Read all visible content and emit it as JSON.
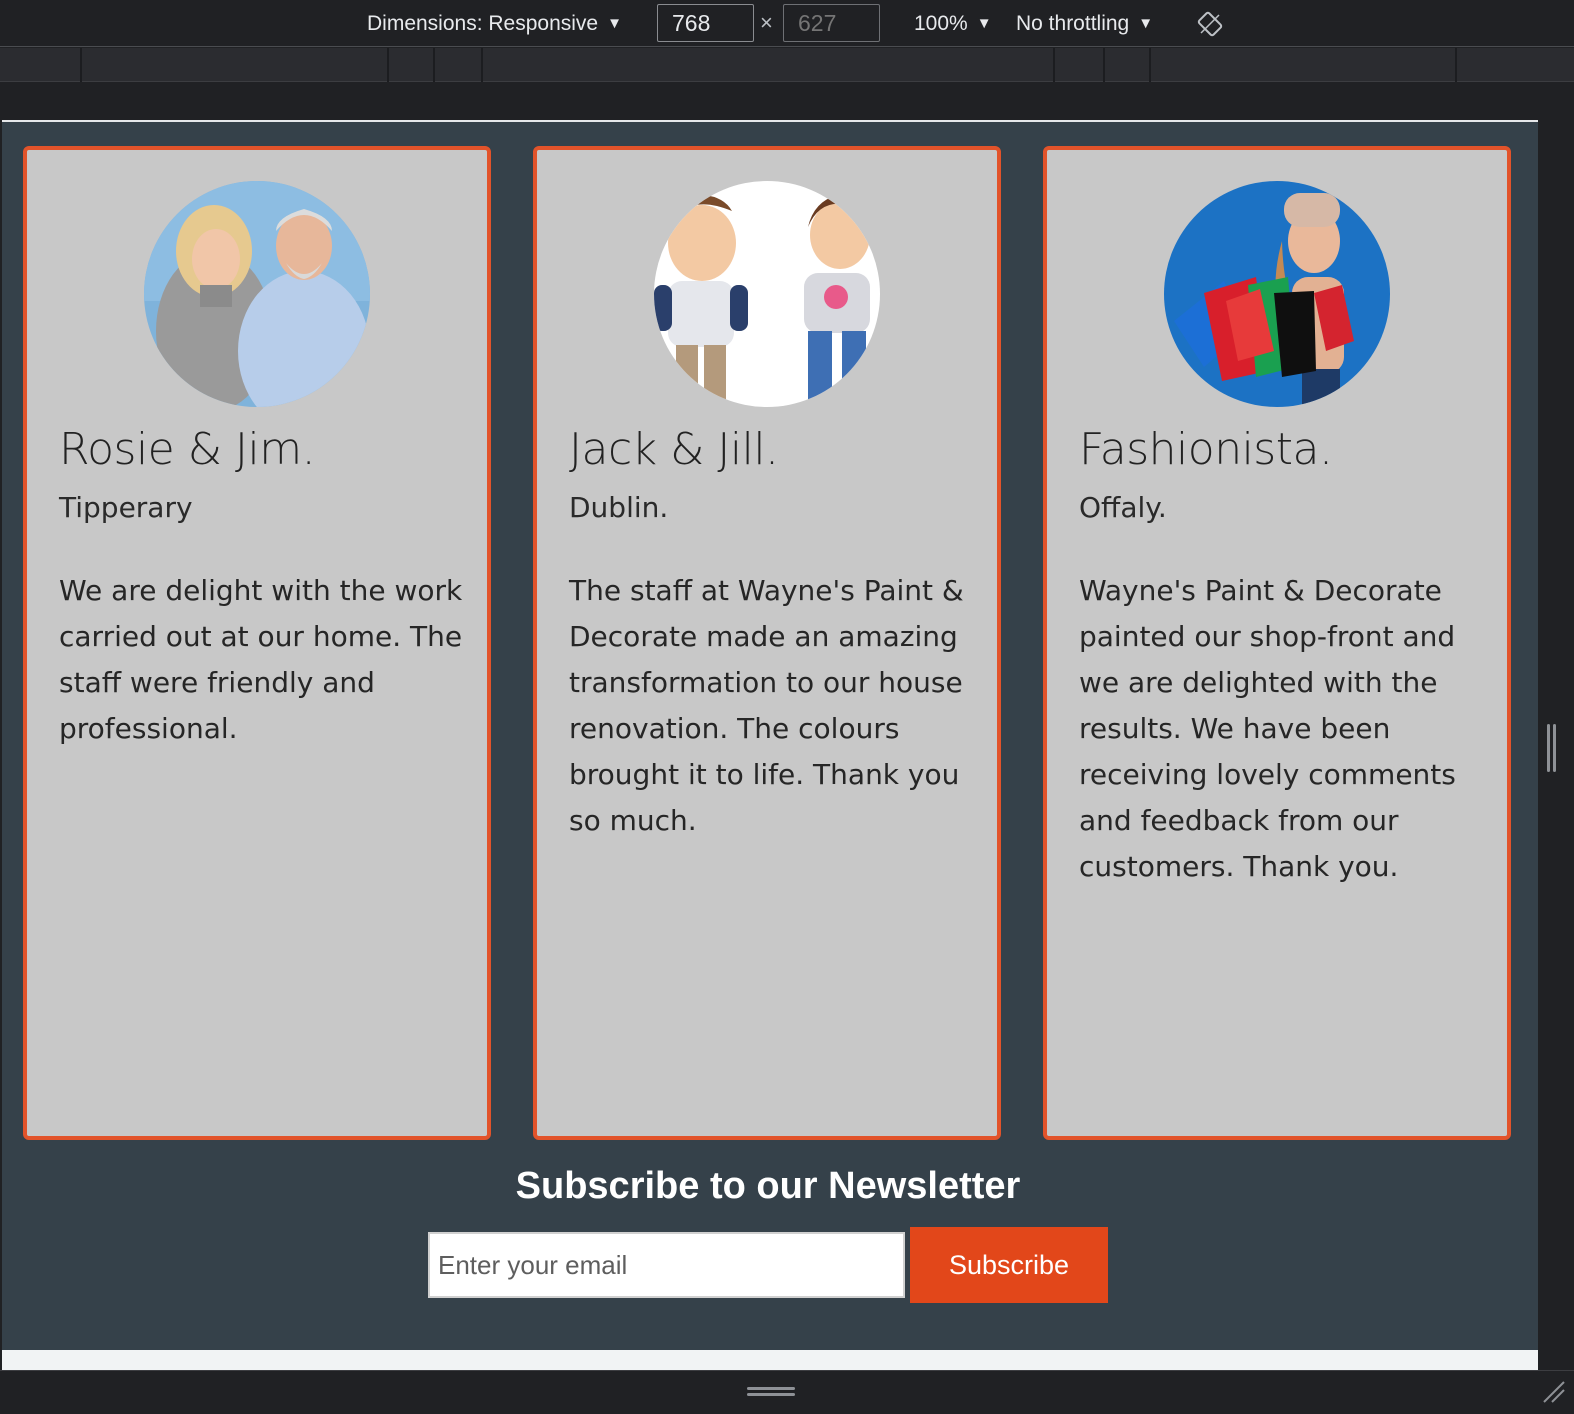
{
  "devtools": {
    "dimensions_label": "Dimensions: Responsive",
    "width_value": "768",
    "times_sign": "×",
    "height_placeholder": "627",
    "zoom_label": "100%",
    "throttle_label": "No throttling",
    "dropdown_glyph": "▼"
  },
  "testimonials": [
    {
      "name": "Rosie & Jim.",
      "place": "Tipperary",
      "text": "We are delight with the work carried out at our home. The staff were friendly and professional."
    },
    {
      "name": "Jack & Jill.",
      "place": "Dublin.",
      "text": "The staff at Wayne's Paint & Decorate made an amazing transformation to our house renovation. The colours brought it to life. Thank you so much."
    },
    {
      "name": "Fashionista.",
      "place": "Offaly.",
      "text": "Wayne's Paint & Decorate painted our shop-front and we are delighted with the results. We have been receiving lovely comments and feedback from our customers. Thank you."
    }
  ],
  "newsletter": {
    "title": "Subscribe to our Newsletter",
    "email_placeholder": "Enter your email",
    "button_label": "Subscribe"
  },
  "colors": {
    "accent": "#e2471a",
    "card_border": "#e2532a",
    "page_background": "#35414a",
    "card_background": "#c8c8c8"
  }
}
